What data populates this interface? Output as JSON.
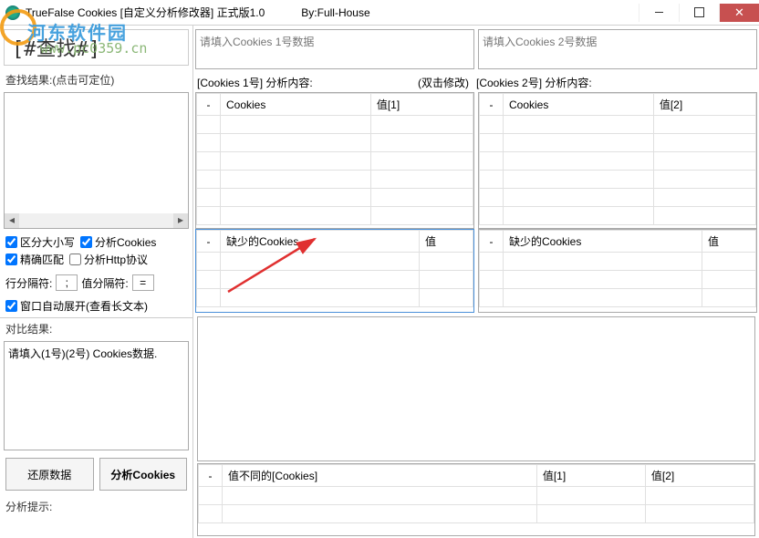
{
  "window": {
    "title": "TrueFalse Cookies [自定义分析修改器] 正式版1.0",
    "byline": "By:Full-House"
  },
  "watermark": {
    "brand": "河东软件园",
    "url": "www.pc0359.cn"
  },
  "search": {
    "placeholder": "[#查找#]"
  },
  "left": {
    "results_label": "查找结果:(点击可定位)",
    "checks": {
      "case_sensitive": "区分大小写",
      "analyze_cookies": "分析Cookies",
      "exact_match": "精确匹配",
      "analyze_http": "分析Http协议"
    },
    "separators": {
      "row_label": "行分隔符:",
      "row_value": ";",
      "val_label": "值分隔符:",
      "val_value": "="
    },
    "auto_expand": "窗口自动展开(查看长文本)",
    "compare_label": "对比结果:",
    "compare_text": "请填入(1号)(2号) Cookies数据.",
    "restore_btn": "还原数据",
    "analyze_btn": "分析Cookies"
  },
  "right": {
    "input1_placeholder": "请填入Cookies 1号数据",
    "input2_placeholder": "请填入Cookies 2号数据",
    "header1": "[Cookies 1号] 分析内容:",
    "header1_hint": "(双击修改)",
    "header2": "[Cookies 2号] 分析内容:",
    "grid1": {
      "col1": "Cookies",
      "col2": "值[1]"
    },
    "grid2": {
      "col1": "Cookies",
      "col2": "值[2]"
    },
    "missing1": "缺少的Cookies",
    "missing1_val": "值",
    "missing2": "缺少的Cookies",
    "missing2_val": "值",
    "diff": {
      "col1": "值不同的[Cookies]",
      "col2": "值[1]",
      "col3": "值[2]"
    }
  },
  "hint_label": "分析提示:"
}
